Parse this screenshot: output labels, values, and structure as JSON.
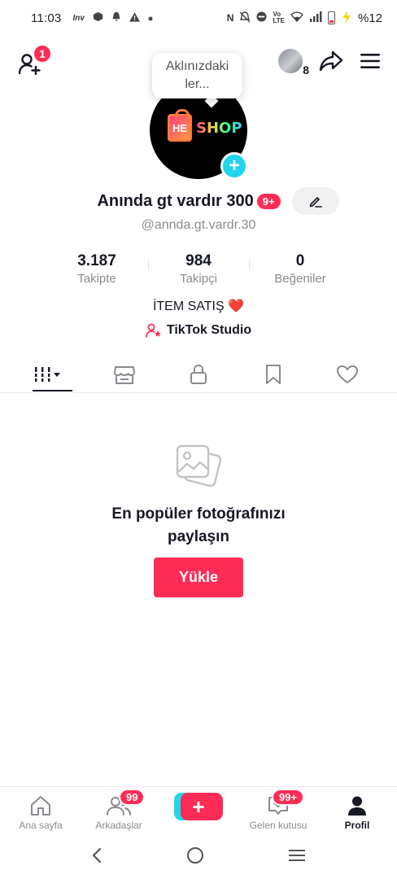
{
  "status_bar": {
    "time": "11:03",
    "left_icons": [
      "inv-icon",
      "box-icon",
      "bell-icon",
      "warning-icon",
      "dot-icon"
    ],
    "right_icons": [
      "nfc-icon",
      "mute-icon",
      "dnd-icon",
      "volte-icon",
      "wifi-icon",
      "signal-icon",
      "battery-icon"
    ],
    "battery": "%12"
  },
  "header": {
    "add_friend_badge": "1",
    "mini_avatar_count": "8"
  },
  "tooltip": {
    "text": "Aklınızdaki ler..."
  },
  "avatar": {
    "logo_letters": "HE",
    "logo_text": "SHOP"
  },
  "profile": {
    "display_name": "Anında gt vardır 300",
    "name_badge": "9+",
    "username": "@annda.gt.vardr.30"
  },
  "stats": [
    {
      "value": "3.187",
      "label": "Takipte"
    },
    {
      "value": "984",
      "label": "Takipçi"
    },
    {
      "value": "0",
      "label": "Beğeniler"
    }
  ],
  "bio": {
    "text": "İTEM SATIŞ",
    "emoji": "❤️"
  },
  "studio": {
    "label": "TikTok Studio"
  },
  "tabs": [
    "videos-grid-icon",
    "shop-icon",
    "lock-icon",
    "bookmark-icon",
    "heart-icon"
  ],
  "empty_state": {
    "title_line1": "En popüler fotoğrafınızı",
    "title_line2": "paylaşın",
    "button": "Yükle"
  },
  "bottom_nav": {
    "home": "Ana sayfa",
    "friends": "Arkadaşlar",
    "friends_badge": "99",
    "inbox": "Gelen kutusu",
    "inbox_badge": "99+",
    "profile": "Profil"
  },
  "colors": {
    "accent": "#fe2c55",
    "cyan": "#20d5ec",
    "text": "#161823",
    "muted": "#8a8b91"
  }
}
